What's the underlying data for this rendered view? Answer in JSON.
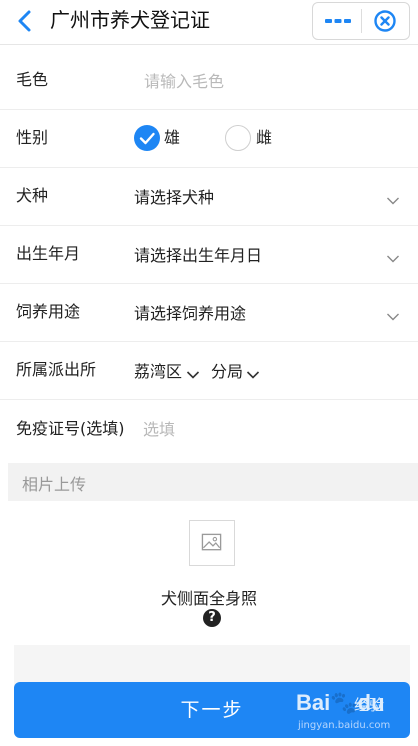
{
  "header": {
    "title": "广州市养犬登记证"
  },
  "form": {
    "coat_color": {
      "label": "毛色",
      "placeholder": "请输入毛色"
    },
    "gender": {
      "label": "性别",
      "option_male": "雄",
      "option_female": "雌",
      "selected": "雄"
    },
    "breed": {
      "label": "犬种",
      "value": "请选择犬种"
    },
    "birth": {
      "label": "出生年月",
      "value": "请选择出生年月日"
    },
    "purpose": {
      "label": "饲养用途",
      "value": "请选择饲养用途"
    },
    "police_station": {
      "label": "所属派出所",
      "district": "荔湾区",
      "branch": "分局"
    },
    "vaccine": {
      "label": "免疫证号(选填)",
      "placeholder": "选填"
    }
  },
  "photo_section": {
    "title": "相片上传",
    "caption": "犬侧面全身照",
    "help_glyph": "?"
  },
  "footer": {
    "next_label": "下一步"
  },
  "watermark": {
    "brand": "Bai",
    "brand_suffix": "du",
    "product": "经验",
    "url": "jingyan.baidu.com"
  },
  "colors": {
    "accent": "#1e86f4",
    "placeholder": "#b9b9b9",
    "divider": "#ededed"
  }
}
